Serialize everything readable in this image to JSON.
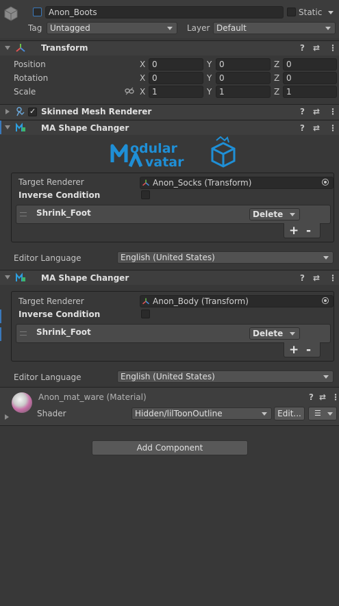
{
  "gameobject": {
    "name": "Anon_Boots",
    "static_label": "Static",
    "tag_label": "Tag",
    "tag_value": "Untagged",
    "layer_label": "Layer",
    "layer_value": "Default"
  },
  "transform": {
    "title": "Transform",
    "rows": [
      {
        "label": "Position",
        "x": "0",
        "y": "0",
        "z": "0"
      },
      {
        "label": "Rotation",
        "x": "0",
        "y": "0",
        "z": "0"
      },
      {
        "label": "Scale",
        "x": "1",
        "y": "1",
        "z": "1"
      }
    ],
    "axis": {
      "x": "X",
      "y": "Y",
      "z": "Z"
    }
  },
  "skinned_mesh": {
    "title": "Skinned Mesh Renderer"
  },
  "shape_changers": [
    {
      "title": "MA Shape Changer",
      "target_label": "Target Renderer",
      "target_value": "Anon_Socks (Transform)",
      "inverse_label": "Inverse Condition",
      "item_name": "Shrink_Foot",
      "item_action": "Delete",
      "editor_language_label": "Editor Language",
      "editor_language_value": "English (United States)"
    },
    {
      "title": "MA Shape Changer",
      "target_label": "Target Renderer",
      "target_value": "Anon_Body (Transform)",
      "inverse_label": "Inverse Condition",
      "item_name": "Shrink_Foot",
      "item_action": "Delete",
      "editor_language_label": "Editor Language",
      "editor_language_value": "English (United States)"
    }
  ],
  "logo": {
    "line1": "odular",
    "line2": "vatar"
  },
  "material": {
    "name": "Anon_mat_ware (Material)",
    "shader_label": "Shader",
    "shader_value": "Hidden/lilToonOutline",
    "edit_label": "Edit..."
  },
  "list_controls": {
    "add": "+",
    "remove": "-"
  },
  "add_component_label": "Add Component",
  "colors": {
    "accent": "#3a79bb",
    "logo": "#1f8fd6"
  },
  "icons": [
    "gameobject-cube-icon",
    "help-icon",
    "presets-icon",
    "kebab-menu-icon",
    "transform-axes-icon",
    "skinned-mesh-icon",
    "modular-avatar-icon",
    "material-sphere-icon",
    "constraint-link-icon",
    "object-picker-icon",
    "drag-handle-icon",
    "checkmark-icon"
  ]
}
